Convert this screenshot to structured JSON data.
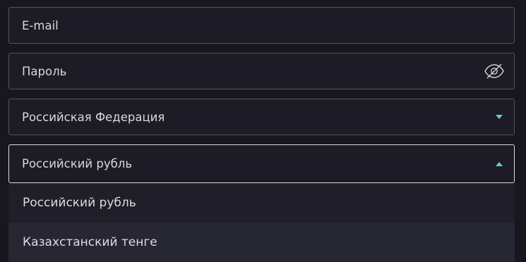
{
  "form": {
    "email": {
      "placeholder": "E-mail",
      "value": ""
    },
    "password": {
      "placeholder": "Пароль",
      "value": "",
      "toggle_icon": "eye-off-icon"
    },
    "country": {
      "selected": "Российская Федерация",
      "state": "collapsed"
    },
    "currency": {
      "selected": "Российский рубль",
      "state": "expanded"
    }
  },
  "currency_options": [
    {
      "label": "Российский рубль"
    },
    {
      "label": "Казахстанский тенге"
    }
  ],
  "colors": {
    "accent": "#5fd6c1",
    "background": "#18171f",
    "field_border": "#55535f",
    "active_border": "#d9d9de"
  }
}
